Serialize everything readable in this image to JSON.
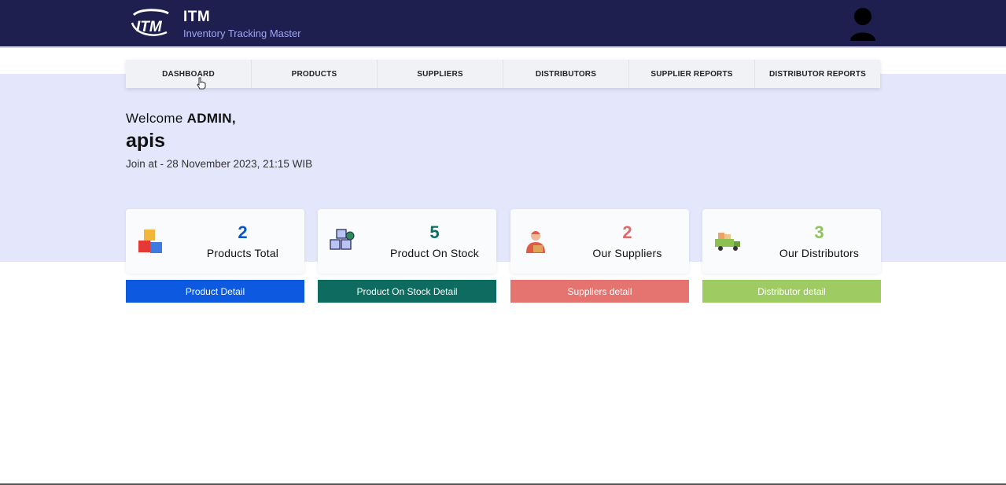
{
  "header": {
    "logo_text": "ITM",
    "title": "ITM",
    "subtitle": "Inventory Tracking Master"
  },
  "nav": {
    "items": [
      {
        "label": "DASHBOARD"
      },
      {
        "label": "PRODUCTS"
      },
      {
        "label": "SUPPLIERS"
      },
      {
        "label": "DISTRIBUTORS"
      },
      {
        "label": "SUPPLIER REPORTS"
      },
      {
        "label": "DISTRIBUTOR REPORTS"
      }
    ]
  },
  "welcome": {
    "greeting": "Welcome",
    "role": "ADMIN,",
    "username": "apis",
    "join_text": "Join at - 28 November 2023, 21:15 WIB"
  },
  "cards": [
    {
      "value": "2",
      "label": "Products Total",
      "icon": "blocks-icon",
      "color": "#0f55c9",
      "button": "Product Detail",
      "button_color": "#0d5ae0"
    },
    {
      "value": "5",
      "label": "Product On Stock",
      "icon": "boxes-stock-icon",
      "color": "#0e6e62",
      "button": "Product On Stock Detail",
      "button_color": "#0d6b5f"
    },
    {
      "value": "2",
      "label": "Our Suppliers",
      "icon": "supplier-person-icon",
      "color": "#e06a6a",
      "button": "Suppliers detail",
      "button_color": "#e57370"
    },
    {
      "value": "3",
      "label": "Our Distributors",
      "icon": "delivery-truck-icon",
      "color": "#8ec45a",
      "button": "Distributor detail",
      "button_color": "#9fcb63"
    }
  ],
  "colors": {
    "topbar": "#1e1e4f",
    "hero": "#e4e6fb",
    "subtitle": "#9fa6f5"
  }
}
